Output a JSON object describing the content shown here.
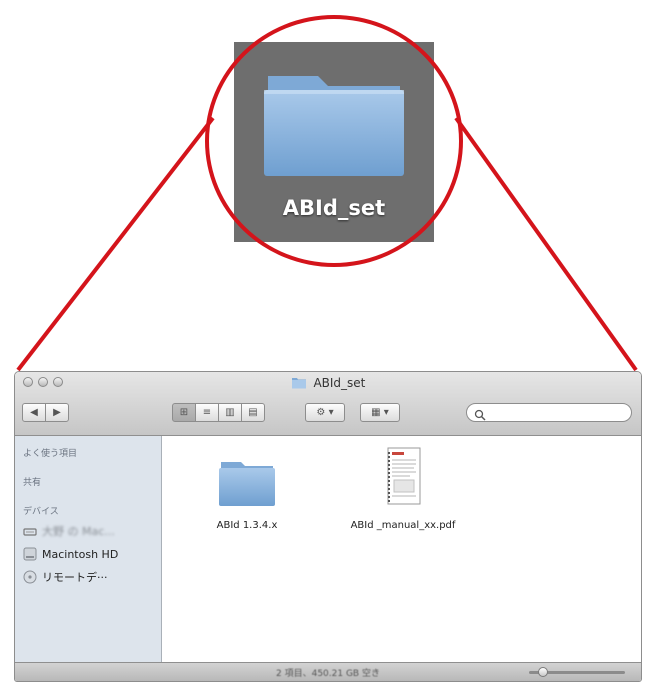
{
  "zoom": {
    "folder_label": "ABId_set"
  },
  "window": {
    "title": "ABId_set",
    "search": {
      "value": "",
      "placeholder": ""
    }
  },
  "sidebar": {
    "sections": [
      {
        "heading": "よく使う項目"
      },
      {
        "heading": "共有"
      },
      {
        "heading": "デバイス"
      }
    ],
    "devices": [
      {
        "label": "大野 の Mac...",
        "icon": "computer-icon"
      },
      {
        "label": "Macintosh HD",
        "icon": "hard-disk-icon"
      },
      {
        "label": "リモートデ···",
        "icon": "remote-disc-icon"
      }
    ]
  },
  "files": [
    {
      "name": "ABId 1.3.4.x",
      "icon": "folder-icon"
    },
    {
      "name": "ABId _manual_xx.pdf",
      "icon": "pdf-document-icon"
    }
  ],
  "status": {
    "text": "2 項目、450.21 GB 空き"
  },
  "icon_size": 0.15,
  "colors": {
    "callout": "#d4141b",
    "folder": "#8fb6dd",
    "sidebar": "#dde4ec"
  }
}
